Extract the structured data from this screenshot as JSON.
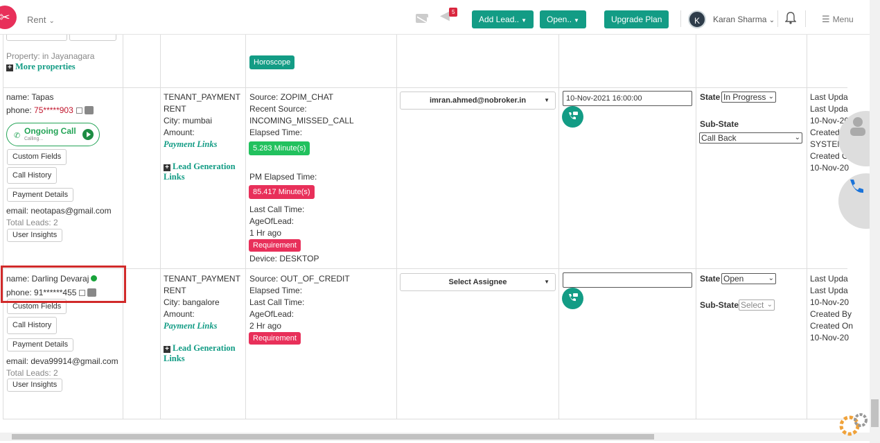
{
  "header": {
    "rent_label": "Rent",
    "notif_count": "5",
    "add_lead": "Add Lead..",
    "open": "Open..",
    "upgrade": "Upgrade Plan",
    "avatar_initial": "K",
    "user_name": "Karan Sharma",
    "menu": "Menu"
  },
  "row0": {
    "property": "Property: in Jayanagara",
    "more_properties": "More properties",
    "horoscope": "Horoscope"
  },
  "row1": {
    "name": "name: Tapas",
    "phone_label": "phone: ",
    "phone": "75*****903",
    "ongoing_call": "Ongoing Call",
    "calling": "Calling...",
    "custom_fields": "Custom Fields",
    "call_history": "Call History",
    "payment_details": "Payment Details",
    "email": "email: neotapas@gmail.com",
    "total_leads": "Total Leads: 2",
    "user_insights": "User Insights",
    "type": "TENANT_PAYMENT",
    "type2": "RENT",
    "city": "City: mumbai",
    "amount": "Amount:",
    "payment_links": "Payment Links",
    "lead_gen_1": "Lead Generation",
    "lead_gen_2": "Links",
    "source": "Source: ZOPIM_CHAT",
    "recent_source": "Recent Source:",
    "recent_source_val": "INCOMING_MISSED_CALL",
    "elapsed": "Elapsed Time:",
    "elapsed_val": "5.283 Minute(s)",
    "pm_elapsed": "PM Elapsed Time:",
    "pm_elapsed_val": "85.417 Minute(s)",
    "last_call": "Last Call Time:",
    "age": "AgeOfLead:",
    "age_val": "1 Hr ago",
    "requirement": "Requirement",
    "device": "Device: DESKTOP",
    "assignee": "imran.ahmed@nobroker.in",
    "datetime": "10-Nov-2021 16:00:00",
    "state_label": "State",
    "state_val": "In Progress",
    "substate_label": "Sub-State",
    "substate_val": "Call Back",
    "upd": [
      "Last Upda",
      "Last Upda",
      "10-Nov-20",
      "Created B",
      "SYSTEM",
      "Created O",
      "10-Nov-20"
    ]
  },
  "row2": {
    "name": "name: Darling Devaraj",
    "phone": "phone: 91******455",
    "custom_fields": "Custom Fields",
    "call_history": "Call History",
    "payment_details": "Payment Details",
    "email": "email: deva99914@gmail.com",
    "total_leads": "Total Leads: 2",
    "user_insights": "User Insights",
    "type": "TENANT_PAYMENT",
    "type2": "RENT",
    "city": "City: bangalore",
    "amount": "Amount:",
    "payment_links": "Payment Links",
    "lead_gen_1": "Lead Generation",
    "lead_gen_2": "Links",
    "source": "Source: OUT_OF_CREDIT",
    "elapsed": "Elapsed Time:",
    "last_call": "Last Call Time:",
    "age": "AgeOfLead:",
    "age_val": "2 Hr ago",
    "requirement": "Requirement",
    "assignee": "Select Assignee",
    "state_label": "State",
    "state_val": "Open",
    "substate_label": "Sub-State",
    "substate_val": "Select",
    "upd": [
      "Last Upda",
      "Last Upda",
      "10-Nov-20",
      "Created By",
      "Created On",
      "10-Nov-20"
    ]
  }
}
